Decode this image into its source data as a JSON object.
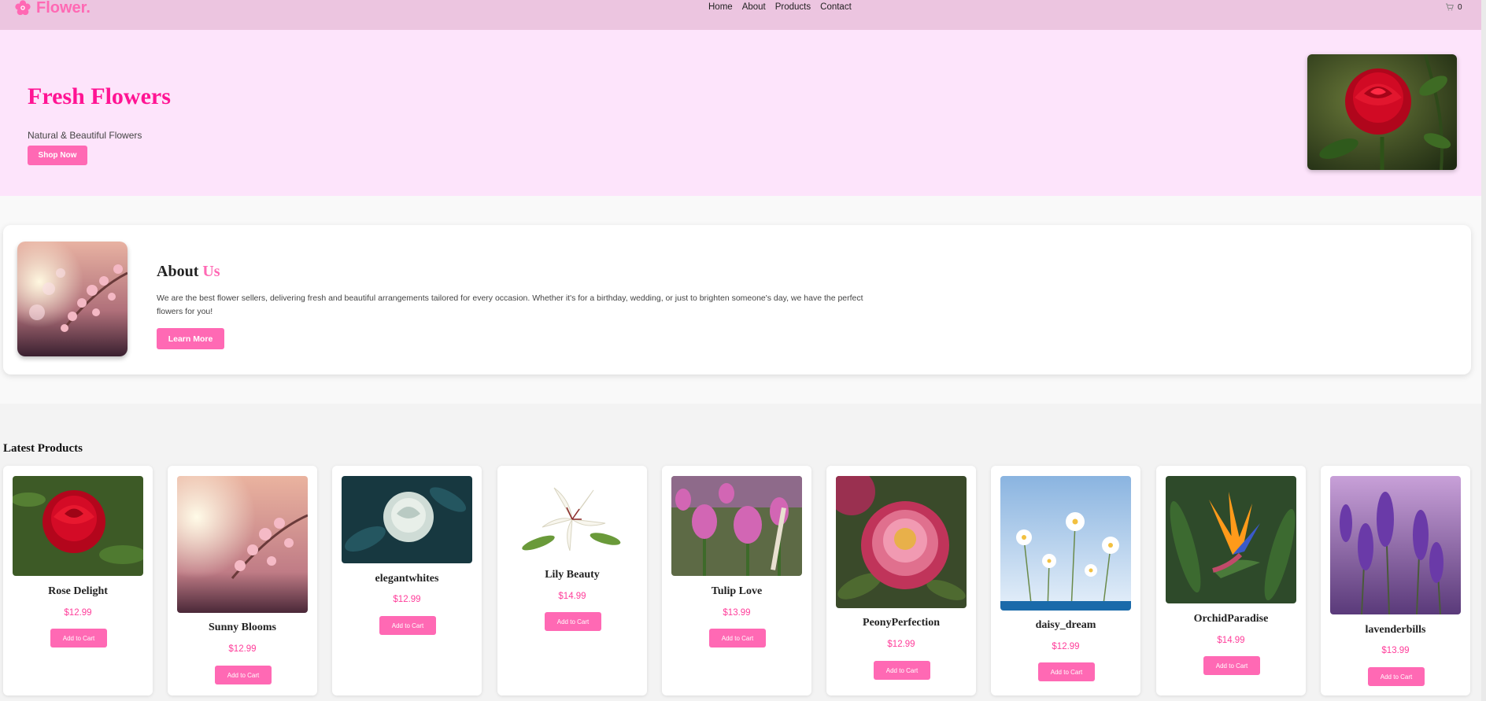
{
  "nav": {
    "logo": "Flower.",
    "links": [
      "Home",
      "About",
      "Products",
      "Contact"
    ],
    "cart_count": "0"
  },
  "hero": {
    "title": "Fresh Flowers",
    "subtitle": "Natural & Beautiful Flowers",
    "button": "Shop Now"
  },
  "about": {
    "heading_main": "About",
    "heading_accent": "Us",
    "text": "We are the best flower sellers, delivering fresh and beautiful arrangements tailored for every occasion. Whether it's for a birthday, wedding, or just to brighten someone's day, we have the perfect flowers for you!",
    "button": "Learn More"
  },
  "products": {
    "title": "Latest Products",
    "add_label": "Add to Cart",
    "items": [
      {
        "name": "Rose Delight",
        "price": "$12.99"
      },
      {
        "name": "Sunny Blooms",
        "price": "$12.99"
      },
      {
        "name": "elegantwhites",
        "price": "$12.99"
      },
      {
        "name": "Lily Beauty",
        "price": "$14.99"
      },
      {
        "name": "Tulip Love",
        "price": "$13.99"
      },
      {
        "name": "PeonyPerfection",
        "price": "$12.99"
      },
      {
        "name": "daisy_dream",
        "price": "$12.99"
      },
      {
        "name": "OrchidParadise",
        "price": "$14.99"
      },
      {
        "name": "lavenderbills",
        "price": "$13.99"
      }
    ]
  },
  "colors": {
    "accent": "#ff69b4",
    "nav_bg": "#ecc5e0",
    "hero_bg": "#fde4fb",
    "title": "#ff1493"
  }
}
